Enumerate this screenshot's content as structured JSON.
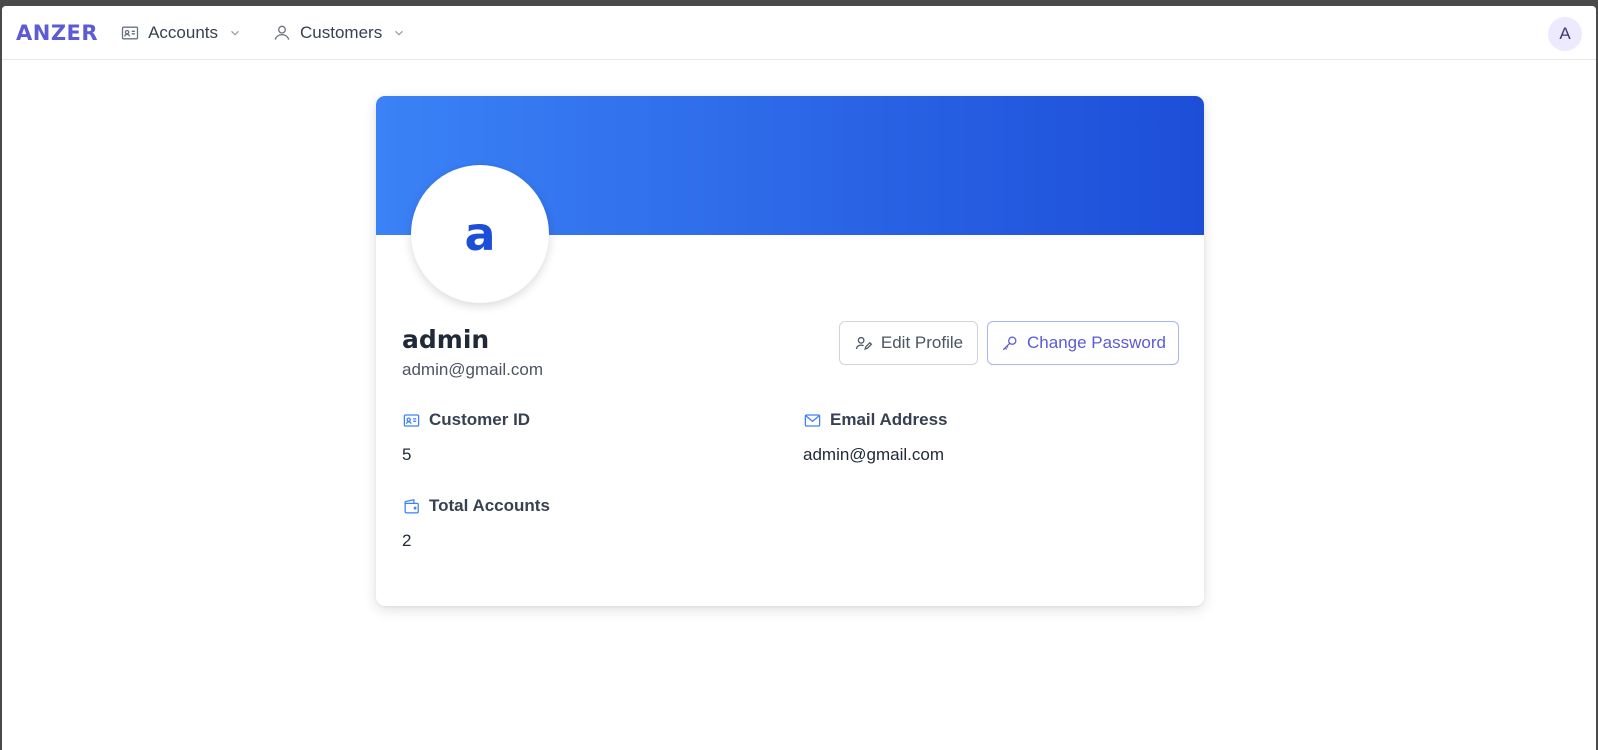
{
  "nav": {
    "brand": "ANZER",
    "items": [
      {
        "label": "Accounts",
        "icon": "id-card-icon"
      },
      {
        "label": "Customers",
        "icon": "user-icon"
      }
    ],
    "user_initial": "A"
  },
  "profile": {
    "avatar_letter": "a",
    "name": "admin",
    "email": "admin@gmail.com",
    "buttons": {
      "edit": "Edit Profile",
      "change_password": "Change Password"
    },
    "fields": {
      "customer_id": {
        "label": "Customer ID",
        "value": "5"
      },
      "email_address": {
        "label": "Email Address",
        "value": "admin@gmail.com"
      },
      "total_accounts": {
        "label": "Total Accounts",
        "value": "2"
      }
    }
  },
  "colors": {
    "brand": "#5b5bd6",
    "banner_start": "#3b82f6",
    "banner_end": "#1d4ed8",
    "icon_blue": "#3b82f6"
  }
}
